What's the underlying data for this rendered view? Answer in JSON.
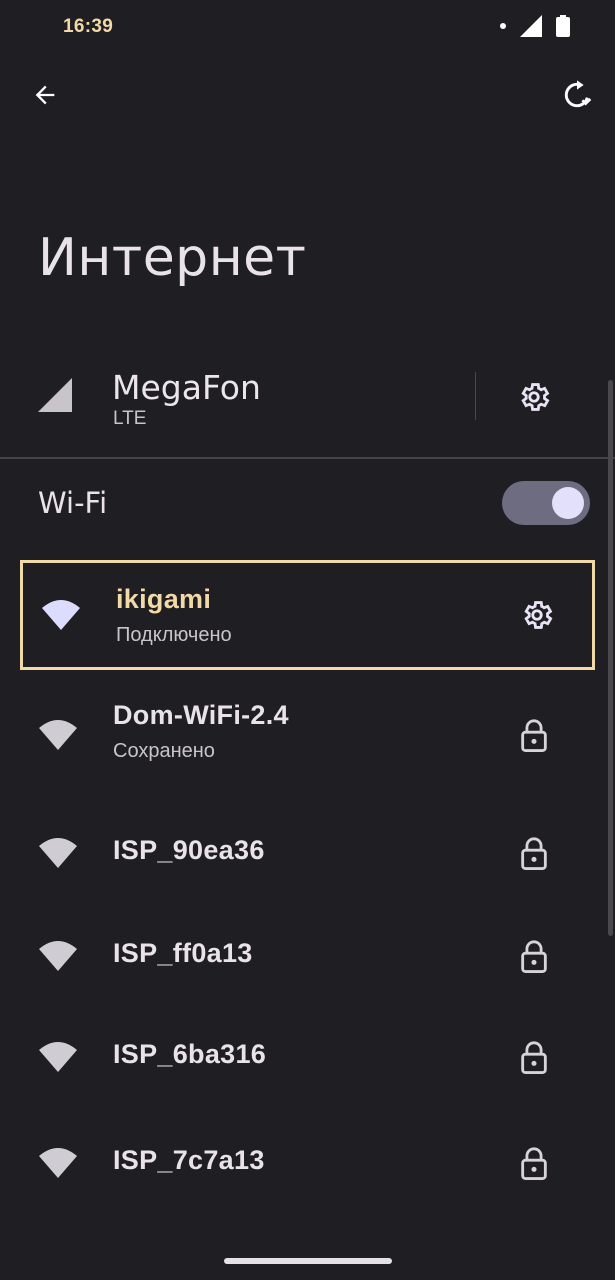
{
  "status_bar": {
    "time": "16:39"
  },
  "page": {
    "title": "Интернет"
  },
  "mobile": {
    "carrier": "MegaFon",
    "network_type": "LTE"
  },
  "wifi": {
    "label": "Wi-Fi",
    "enabled": true,
    "networks": [
      {
        "name": "ikigami",
        "status": "Подключено",
        "action_icon": "gear-icon",
        "connected": true
      },
      {
        "name": "Dom-WiFi-2.4",
        "status": "Сохранено",
        "action_icon": "lock-icon"
      },
      {
        "name": "ISP_90ea36",
        "status": "",
        "action_icon": "lock-icon"
      },
      {
        "name": "ISP_ff0a13",
        "status": "",
        "action_icon": "lock-icon"
      },
      {
        "name": "ISP_6ba316",
        "status": "",
        "action_icon": "lock-icon"
      },
      {
        "name": "ISP_7c7a13",
        "status": "",
        "action_icon": "lock-icon"
      }
    ]
  },
  "colors": {
    "background": "#1f1e22",
    "accent": "#f2d9a8",
    "toggle_track": "#6e6c80",
    "toggle_knob": "#e2e0fb"
  }
}
